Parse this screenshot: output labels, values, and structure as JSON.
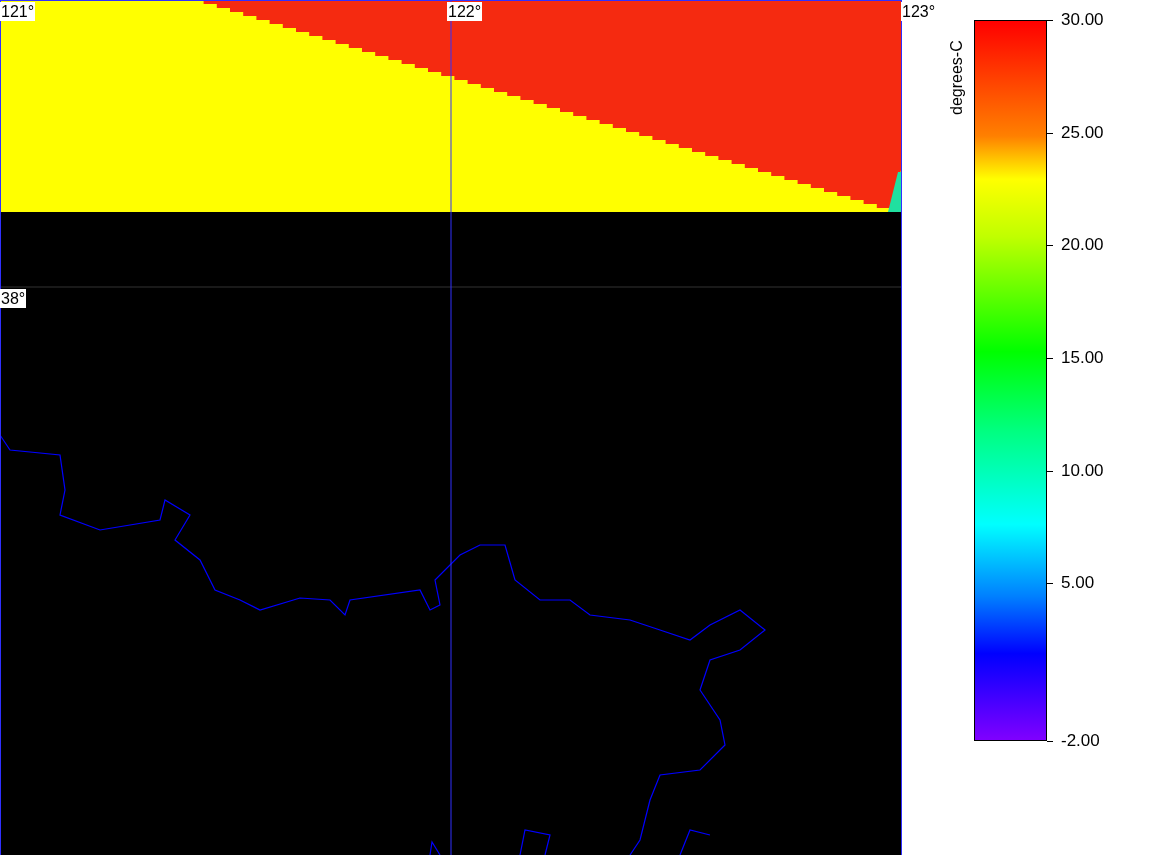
{
  "map": {
    "longitude_labels": [
      "121°",
      "122°",
      "123°"
    ],
    "latitude_labels": [
      "38°"
    ]
  },
  "colorbar": {
    "unit": "degrees-C",
    "ticks": [
      {
        "label": "30.00"
      },
      {
        "label": "25.00"
      },
      {
        "label": "20.00"
      },
      {
        "label": "15.00"
      },
      {
        "label": "10.00"
      },
      {
        "label": "5.00"
      },
      {
        "label": "-2.00"
      }
    ]
  }
}
